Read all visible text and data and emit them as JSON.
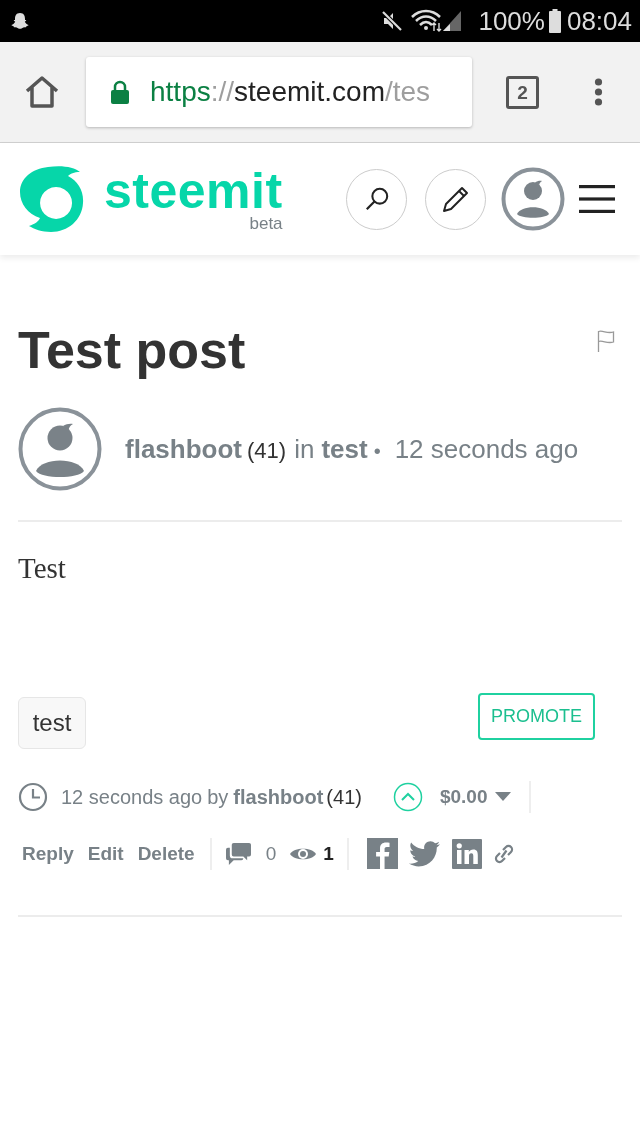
{
  "status_bar": {
    "battery": "100%",
    "time": "08:04"
  },
  "browser": {
    "url": {
      "scheme": "https",
      "separator": "://",
      "host": "steemit.com",
      "path": "/tes"
    },
    "tab_count": "2"
  },
  "site_header": {
    "logo_text": "steemit",
    "logo_badge": "beta"
  },
  "post": {
    "title": "Test post",
    "byline": {
      "author": "flashboot",
      "reputation": "(41)",
      "in_label": "in",
      "category": "test",
      "separator": "•",
      "time": "12 seconds ago"
    },
    "body": "Test",
    "tags": [
      "test"
    ],
    "promote_button": "PROMOTE"
  },
  "post_footer": {
    "time": "12 seconds ago",
    "by_label": "by",
    "author": "flashboot",
    "reputation": "(41)",
    "payout": "$0.00",
    "actions": [
      "Reply",
      "Edit",
      "Delete"
    ],
    "comment_count": "0",
    "view_count": "1"
  }
}
